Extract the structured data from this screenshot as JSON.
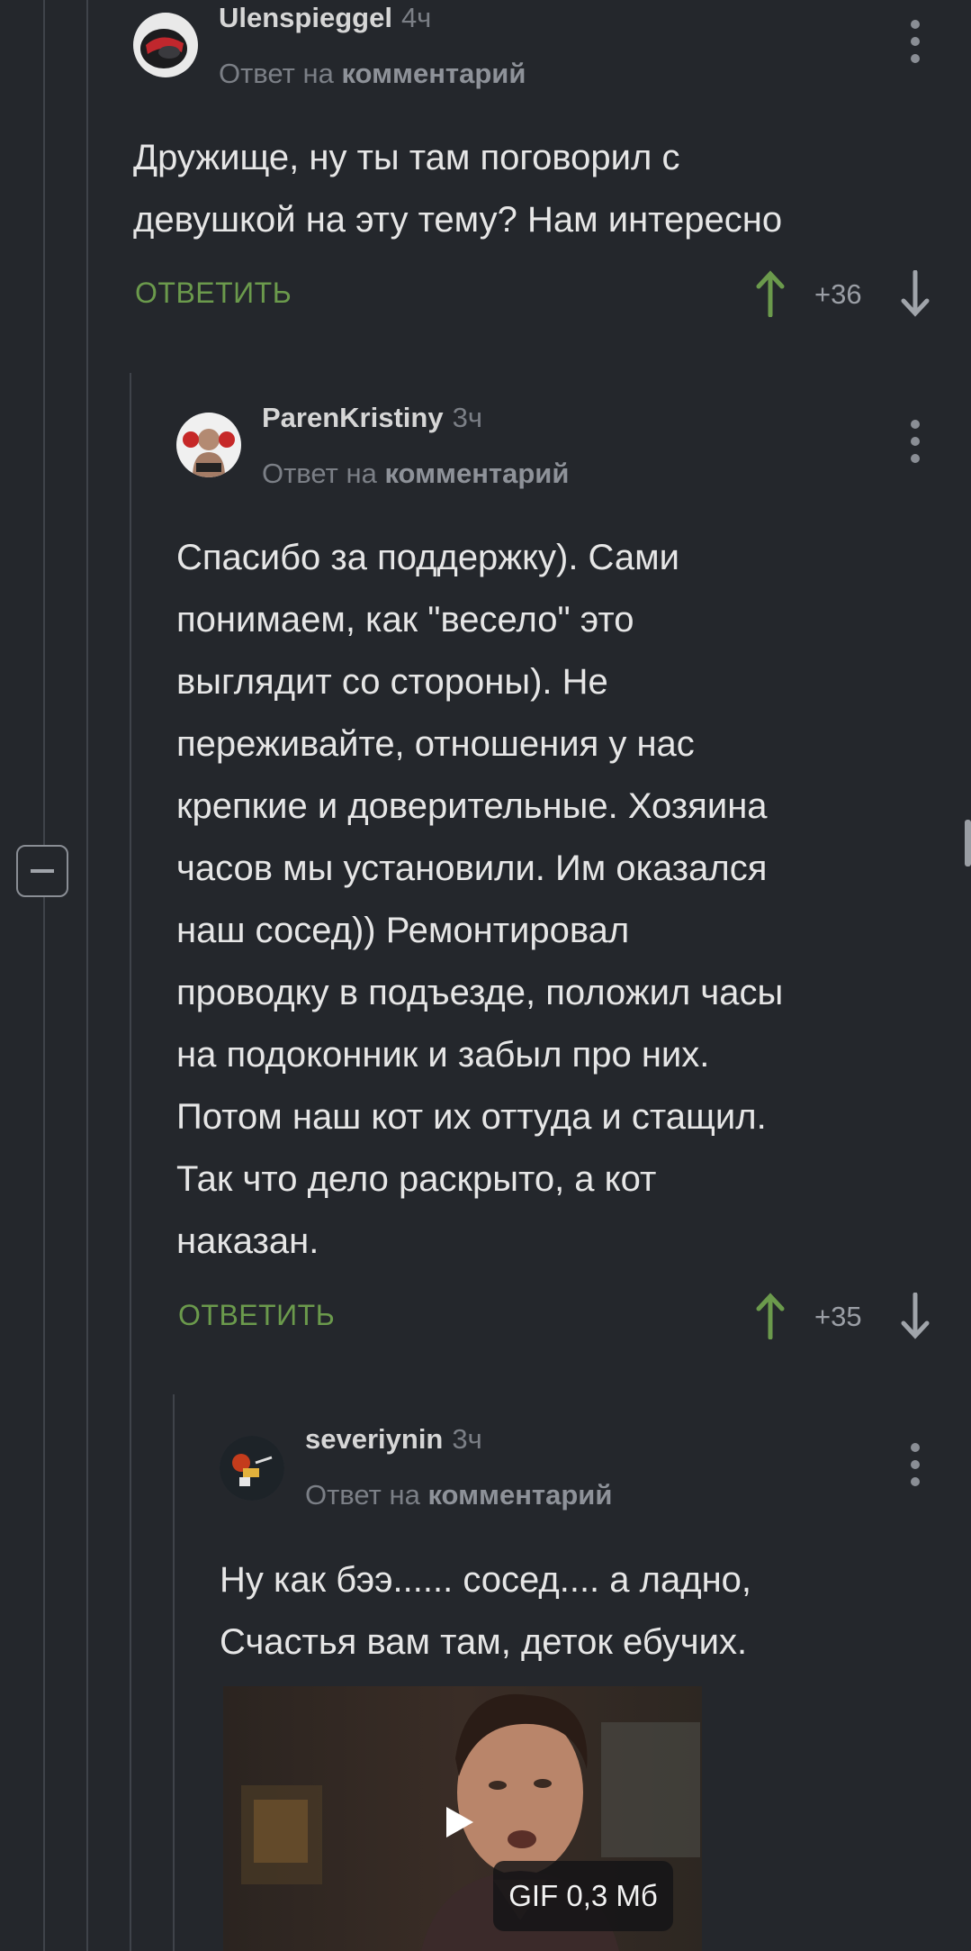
{
  "comments": [
    {
      "username": "Ulenspieggel",
      "time": "4ч",
      "reply_prefix": "Ответ на",
      "reply_target": "комментарий",
      "text": "Дружище, ну ты там поговорил с\nдевушкой на эту тему? Нам интересно",
      "reply_label": "ОТВЕТИТЬ",
      "score": "+36"
    },
    {
      "username": "ParenKristiny",
      "time": "3ч",
      "reply_prefix": "Ответ на",
      "reply_target": "комментарий",
      "text": "Спасибо за поддержку). Сами\nпонимаем, как \"весело\" это\nвыглядит со стороны). Не\nпереживайте, отношения у нас\nкрепкие и доверительные. Хозяина\nчасов мы установили. Им оказался\nнаш сосед)) Ремонтировал\nпроводку в подъезде, положил часы\nна подоконник и забыл про них.\nПотом наш кот их оттуда и стащил.\nТак что дело раскрыто, а кот\nнаказан.",
      "reply_label": "ОТВЕТИТЬ",
      "score": "+35"
    },
    {
      "username": "severiynin",
      "time": "3ч",
      "reply_prefix": "Ответ на",
      "reply_target": "комментарий",
      "text": "Ну как бээ...... сосед.... а ладно,\nСчастья вам там, деток ебучих.",
      "gif_label": "GIF 0,3 Мб"
    }
  ],
  "icons": {
    "menu": "more-vertical-icon",
    "upvote": "arrow-up-icon",
    "downvote": "arrow-down-icon",
    "collapse": "minus-square-icon",
    "play": "play-icon"
  },
  "colors": {
    "background": "#24272c",
    "reply_green": "#6b9a4c",
    "upvote_active": "#6b9a4c",
    "text": "#e6e6e6",
    "muted": "#7b7f86"
  }
}
